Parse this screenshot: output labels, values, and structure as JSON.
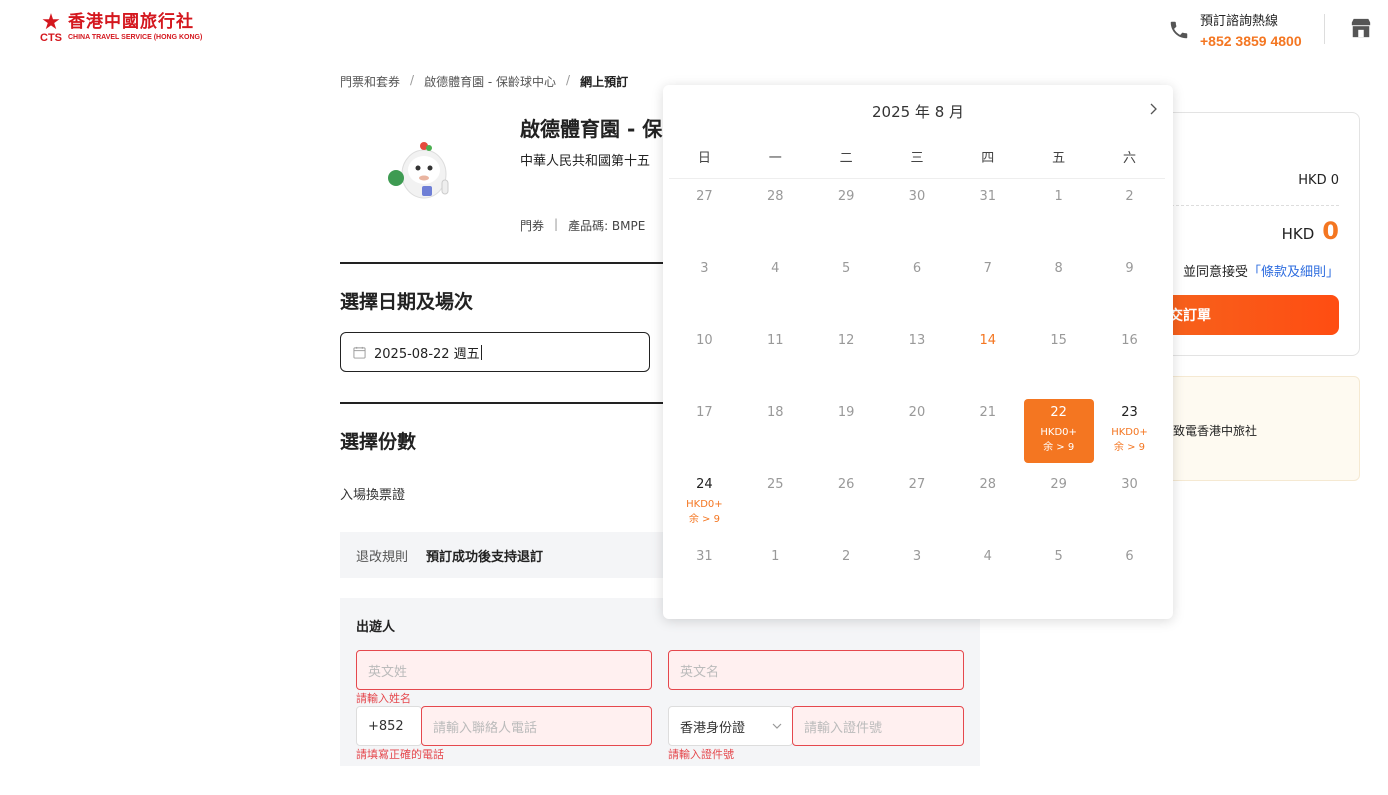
{
  "header": {
    "logo_cn": "香港中國旅行社",
    "logo_cts": "CTS",
    "logo_en": "CHINA TRAVEL SERVICE (HONG KONG)",
    "hotline_title": "預訂諮詢熱線",
    "hotline_number": "+852 3859 4800"
  },
  "breadcrumb": [
    "門票和套券",
    "啟德體育園 - 保齡球中心",
    "網上預訂"
  ],
  "product": {
    "title": "啟德體育園 - 保",
    "subtitle": "中華人民共和國第十五",
    "type": "門券",
    "code": "產品碼: BMPE"
  },
  "date_section": {
    "heading": "選擇日期及場次",
    "value": "2025-08-22 週五"
  },
  "qty_section": {
    "heading": "選擇份數",
    "ticket_label": "入場換票證"
  },
  "policy": {
    "label": "退改規則",
    "value": "預訂成功後支持退訂"
  },
  "traveler": {
    "title": "出遊人",
    "surname_placeholder": "英文姓",
    "givenname_placeholder": "英文名",
    "surname_error": "請輸入姓名",
    "country_code": "+852",
    "phone_placeholder": "請輸入聯絡人電話",
    "phone_error": "請填寫正確的電話",
    "id_type": "香港身份證",
    "id_placeholder": "請輸入證件號",
    "id_error": "請輸入證件號"
  },
  "summary": {
    "subtotal": "HKD 0",
    "total_currency": "HKD",
    "total_amount": "0",
    "terms_prefix": "並同意接受",
    "terms_link": "「條款及細則」",
    "submit_label": "交訂單",
    "notice": "請致電香港中旅社"
  },
  "calendar": {
    "month_label": "2025 年  8 月",
    "weekdays": [
      "日",
      "一",
      "二",
      "三",
      "四",
      "五",
      "六"
    ],
    "weeks": [
      [
        {
          "d": "27"
        },
        {
          "d": "28"
        },
        {
          "d": "29"
        },
        {
          "d": "30"
        },
        {
          "d": "31"
        },
        {
          "d": "1"
        },
        {
          "d": "2"
        }
      ],
      [
        {
          "d": "3"
        },
        {
          "d": "4"
        },
        {
          "d": "5"
        },
        {
          "d": "6"
        },
        {
          "d": "7"
        },
        {
          "d": "8"
        },
        {
          "d": "9"
        }
      ],
      [
        {
          "d": "10"
        },
        {
          "d": "11"
        },
        {
          "d": "12"
        },
        {
          "d": "13"
        },
        {
          "d": "14",
          "state": "today"
        },
        {
          "d": "15"
        },
        {
          "d": "16"
        }
      ],
      [
        {
          "d": "17"
        },
        {
          "d": "18"
        },
        {
          "d": "19"
        },
        {
          "d": "20"
        },
        {
          "d": "21"
        },
        {
          "d": "22",
          "state": "selected",
          "price": "HKD0+",
          "stock": "余 > 9"
        },
        {
          "d": "23",
          "state": "available",
          "price": "HKD0+",
          "stock": "余 > 9"
        }
      ],
      [
        {
          "d": "24",
          "state": "available",
          "price": "HKD0+",
          "stock": "余 > 9"
        },
        {
          "d": "25"
        },
        {
          "d": "26"
        },
        {
          "d": "27"
        },
        {
          "d": "28"
        },
        {
          "d": "29"
        },
        {
          "d": "30"
        }
      ],
      [
        {
          "d": "31"
        },
        {
          "d": "1"
        },
        {
          "d": "2"
        },
        {
          "d": "3"
        },
        {
          "d": "4"
        },
        {
          "d": "5"
        },
        {
          "d": "6"
        }
      ]
    ]
  },
  "colors": {
    "accent": "#f47621",
    "brand_red": "#d4171e",
    "error": "#e5484d"
  }
}
